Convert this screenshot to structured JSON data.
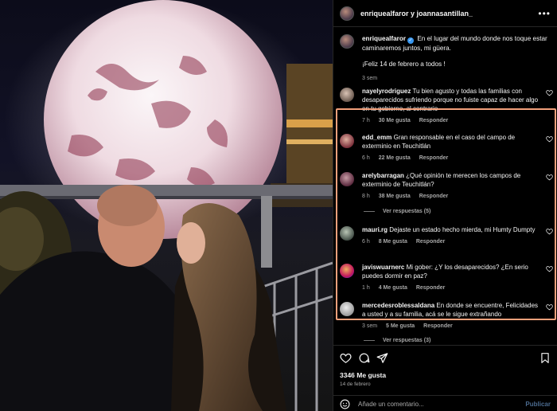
{
  "header": {
    "names": "enriquealfaror y joannasantillan_",
    "more_icon": "more-horizontal-icon"
  },
  "caption": {
    "username": "enriquealfaror",
    "text": "En el lugar del mundo donde nos toque estar caminaremos juntos, mi güera.",
    "text2": "¡Feliz 14 de febrero a todos !",
    "time": "3 sem"
  },
  "comments": [
    {
      "username": "nayelyrodriguez",
      "text": "Tu bien agusto y todas las familias con desaparecidos sufriendo porque no fuiste capaz de hacer algo en tu gobierno, al contrario",
      "time": "7 h",
      "likes": "30 Me gusta",
      "reply": "Responder"
    },
    {
      "username": "edd_emm",
      "text": "Gran responsable en el caso del campo de exterminio en Teuchitlán",
      "time": "6 h",
      "likes": "22 Me gusta",
      "reply": "Responder"
    },
    {
      "username": "arelybarragan",
      "text": "¿Qué opinión te merecen los campos de exterminio de Teuchitlán?",
      "time": "8 h",
      "likes": "38 Me gusta",
      "reply": "Responder",
      "view_replies": "Ver respuestas (5)"
    },
    {
      "username": "mauri.rg",
      "text": "Dejaste un estado hecho mierda, mi Humty Dumpty",
      "time": "6 h",
      "likes": "8 Me gusta",
      "reply": "Responder"
    },
    {
      "username": "javiswuarnerc",
      "text": "Mi gober: ¿Y los desaparecidos? ¿En serio puedes dormir en paz?",
      "time": "1 h",
      "likes": "4 Me gusta",
      "reply": "Responder"
    },
    {
      "username": "mercedesroblessaldana",
      "text": "En donde se encuentre, Felicidades a usted y a su familia, acá se le sigue extrañando",
      "time": "3 sem",
      "likes": "5 Me gusta",
      "reply": "Responder",
      "view_replies": "Ver respuestas (3)"
    }
  ],
  "actions": {
    "likes": "3346 Me gusta",
    "date": "14 de febrero",
    "comment_placeholder": "Añade un comentario...",
    "publish": "Publicar",
    "icons": [
      "heart-icon",
      "comment-icon",
      "share-icon",
      "bookmark-icon",
      "emoji-icon"
    ]
  },
  "colors": {
    "highlight_border": "#f2a07b",
    "verified_badge": "#3897f0",
    "publish_disabled": "#4b6a8e"
  }
}
